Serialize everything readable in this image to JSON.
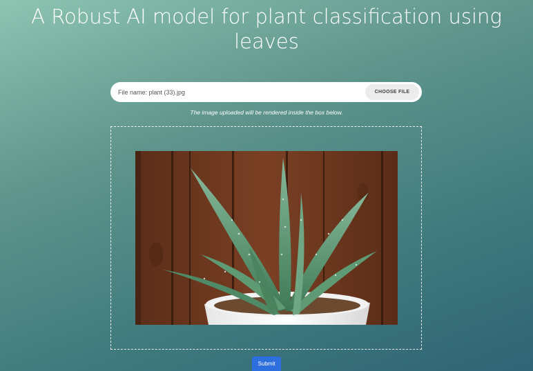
{
  "page": {
    "title": "A Robust AI model for plant classification using leaves"
  },
  "upload": {
    "file_name_text": "File name: plant (33).jpg",
    "choose_button_label": "CHOOSE FILE",
    "hint": "The image uploaded will be rendered inside the box below."
  },
  "preview": {
    "image_description_icon": "aloe-vera-plant-photo"
  },
  "actions": {
    "submit_label": "Submit"
  },
  "colors": {
    "background_top": "#8ec4b2",
    "background_bottom": "#2f6475",
    "submit_button": "#2e6fe0"
  }
}
